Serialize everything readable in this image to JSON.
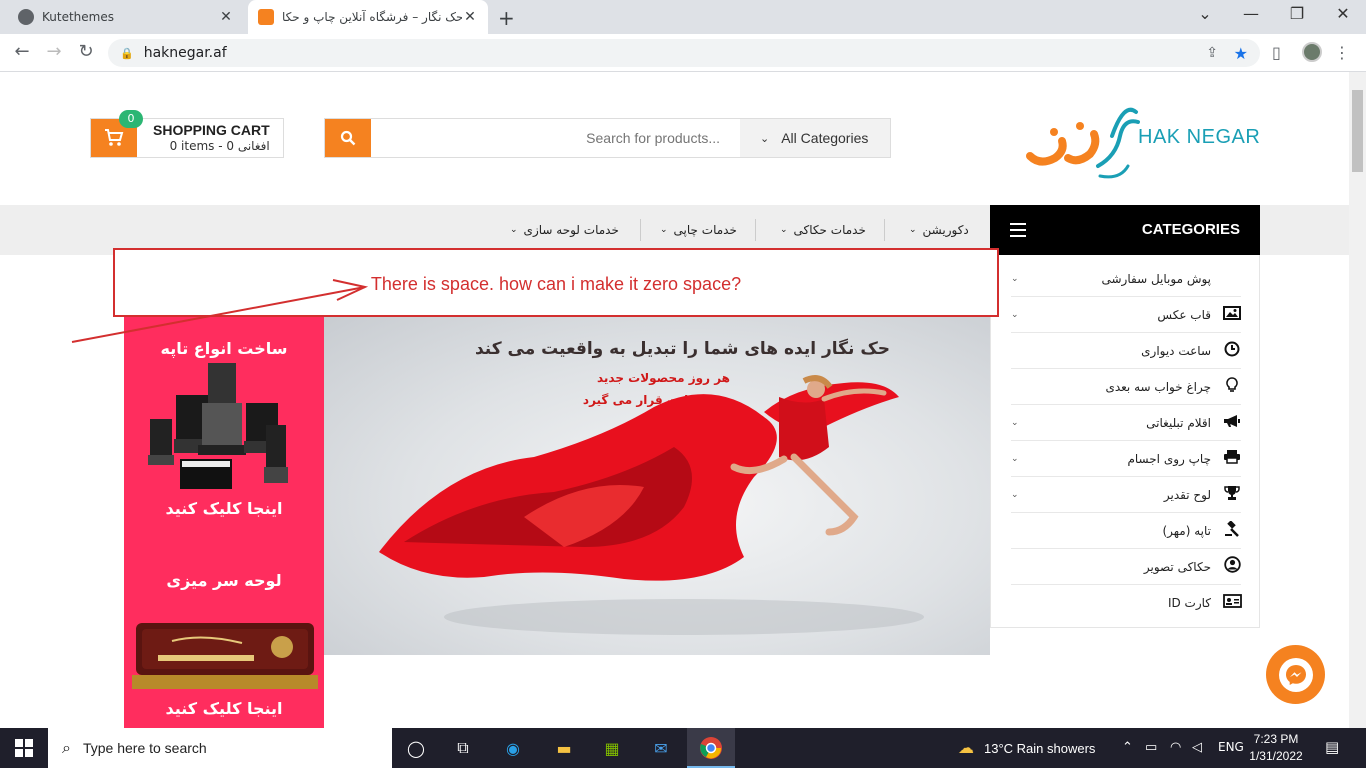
{
  "browser": {
    "tabs": [
      {
        "title": "Kutethemes",
        "active": false
      },
      {
        "title": "حک نگار – فرشگاه آنلاین چاپ و حکا",
        "active": true
      }
    ],
    "url": "haknegar.af"
  },
  "header": {
    "cart": {
      "badge": "0",
      "title": "SHOPPING CART",
      "summary": "0 items - 0 افغانی"
    },
    "search": {
      "placeholder": "Search for products...",
      "category": "All Categories"
    },
    "logo_text": "HAK NEGAR"
  },
  "nav": {
    "categories_title": "CATEGORIES",
    "menu": [
      {
        "label": "دکوریشن"
      },
      {
        "label": "خدمات حکاکی"
      },
      {
        "label": "خدمات چاپی"
      },
      {
        "label": "خدمات لوحه سازی"
      }
    ]
  },
  "categories": [
    {
      "label": "پوش موبایل سفارشی",
      "icon": "none",
      "has_children": true
    },
    {
      "label": "قاب عکس",
      "icon": "image-icon",
      "has_children": true
    },
    {
      "label": "ساعت دیواری",
      "icon": "clock-icon",
      "has_children": false
    },
    {
      "label": "چراغ خواب سه بعدی",
      "icon": "lightbulb-icon",
      "has_children": false
    },
    {
      "label": "اقلام تبلیغاتی",
      "icon": "megaphone-icon",
      "has_children": true
    },
    {
      "label": "چاپ روی اجسام",
      "icon": "printer-icon",
      "has_children": true
    },
    {
      "label": "لوح تقدیر",
      "icon": "trophy-icon",
      "has_children": true
    },
    {
      "label": "تاپه (مهر)",
      "icon": "gavel-icon",
      "has_children": false
    },
    {
      "label": "حکاکی تصویر",
      "icon": "user-circle-icon",
      "has_children": false
    },
    {
      "label": "ID کارت",
      "icon": "id-card-icon",
      "has_children": false
    }
  ],
  "annotation": {
    "text": "There is space. how can i make it zero space?"
  },
  "side_banner": {
    "title1": "ساخت انواع تاپه",
    "cta1": "اینجا کلیک کنید",
    "title2": "لوحه سر میزی",
    "cta2": "اینجا کلیک کنید"
  },
  "hero": {
    "title": "حک نگار ایده های شما را تبدیل به واقعیت می کند",
    "subtitle1": "هر روز محصولات جدید",
    "subtitle2": "در وبسایت قرار می گیرد"
  },
  "taskbar": {
    "search_placeholder": "Type here to search",
    "weather": "13°C  Rain showers",
    "language": "ENG",
    "time": "7:23 PM",
    "date": "1/31/2022"
  },
  "colors": {
    "accent": "#f58220",
    "brand_teal": "#1a9fb5",
    "banner_pink": "#ff2d5e",
    "annotation_red": "#d32f2f"
  }
}
